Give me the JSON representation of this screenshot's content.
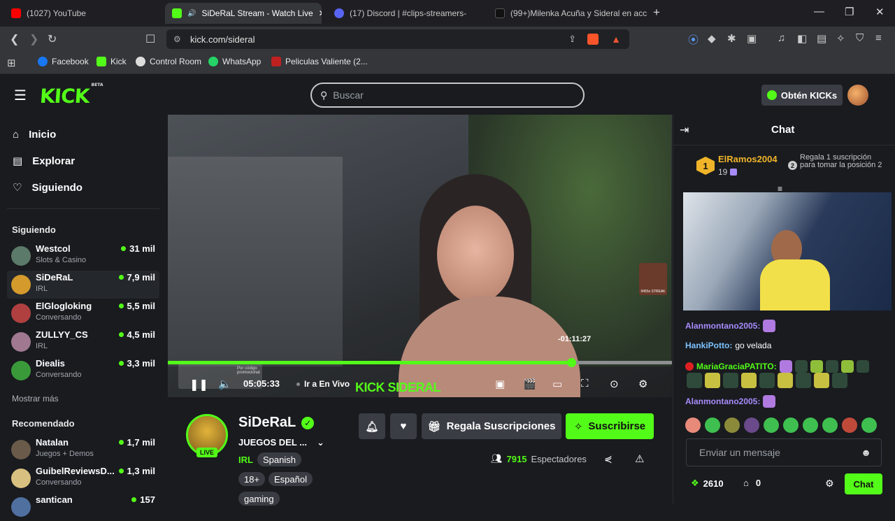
{
  "browser": {
    "tabs": [
      {
        "title": "(1027) YouTube"
      },
      {
        "title": "SiDeRaL Stream - Watch Live"
      },
      {
        "title": "(17) Discord | #clips-streamers-"
      },
      {
        "title": "(99+)Milenka Acuña y Sideral en acc"
      }
    ],
    "url": "kick.com/sideral",
    "bookmarks": [
      "Facebook",
      "Kick",
      "Control Room",
      "WhatsApp",
      "Peliculas Valiente (2..."
    ]
  },
  "kick": {
    "logo": "KICK",
    "logo_beta": "BETA",
    "search_placeholder": "Buscar",
    "get_kicks": "Obtén KICKs",
    "nav": [
      "Inicio",
      "Explorar",
      "Siguiendo"
    ],
    "following_header": "Siguiendo",
    "following": [
      {
        "name": "Westcol",
        "category": "Slots & Casino",
        "viewers": "31 mil",
        "color": "#5c7a6a"
      },
      {
        "name": "SiDeRaL",
        "category": "IRL",
        "viewers": "7,9 mil",
        "color": "#d59a2c"
      },
      {
        "name": "ElGlogloking",
        "category": "Conversando",
        "viewers": "5,5 mil",
        "color": "#b04040"
      },
      {
        "name": "ZULLYY_CS",
        "category": "IRL",
        "viewers": "4,5 mil",
        "color": "#a07890"
      },
      {
        "name": "Diealis",
        "category": "Conversando",
        "viewers": "3,3 mil",
        "color": "#3a9a3a"
      }
    ],
    "show_more": "Mostrar más",
    "recommended_header": "Recomendado",
    "recommended": [
      {
        "name": "Natalan",
        "category": "Juegos + Demos",
        "viewers": "1,7 mil",
        "color": "#6a5a4a"
      },
      {
        "name": "GuibelReviewsD...",
        "category": "Conversando",
        "viewers": "1,3 mil",
        "color": "#d8c080"
      },
      {
        "name": "santican",
        "category": "",
        "viewers": "157",
        "color": "#5070a0"
      }
    ]
  },
  "player": {
    "time_remaining": "-01:11:27",
    "elapsed": "05:05:33",
    "go_live": "Ir a En Vivo",
    "watermark": "KICK SIDERAL",
    "progress": 0.8,
    "streak_label": "9455x STREAK",
    "preview_text": "Por código promocional"
  },
  "stream": {
    "streamer": "SiDeRaL",
    "title": "JUEGOS DEL ...",
    "live_badge": "LIVE",
    "category": "IRL",
    "tags": [
      "Spanish",
      "18+",
      "Español",
      "gaming"
    ],
    "gift_subs": "Regala Suscripciones",
    "subscribe": "Suscribirse",
    "viewers_count": "7915",
    "viewers_label": "Espectadores"
  },
  "chat": {
    "title": "Chat",
    "top_gifter_rank": "1",
    "top_gifter_name": "ElRamos2004",
    "top_gifter_count": "19",
    "gift_prompt": "Regala 1 suscripción para tomar la posición 2",
    "gift_rank": "2",
    "messages": [
      {
        "user": "Alanmontano2005:",
        "text": "",
        "color": "#a78bfa"
      },
      {
        "user": "HankiPotto:",
        "text": "go velada",
        "color": "#7cc3ff"
      },
      {
        "user": "MariaGraciaPATITO:",
        "text": "",
        "color": "#53fc18"
      },
      {
        "user": "Alanmontano2005:",
        "text": "",
        "color": "#a78bfa"
      }
    ],
    "input_placeholder": "Enviar un mensaje",
    "kicks_balance": "2610",
    "store_count": "0",
    "send_label": "Chat"
  },
  "colors": {
    "accent": "#53fc18",
    "background": "#191b1f"
  }
}
